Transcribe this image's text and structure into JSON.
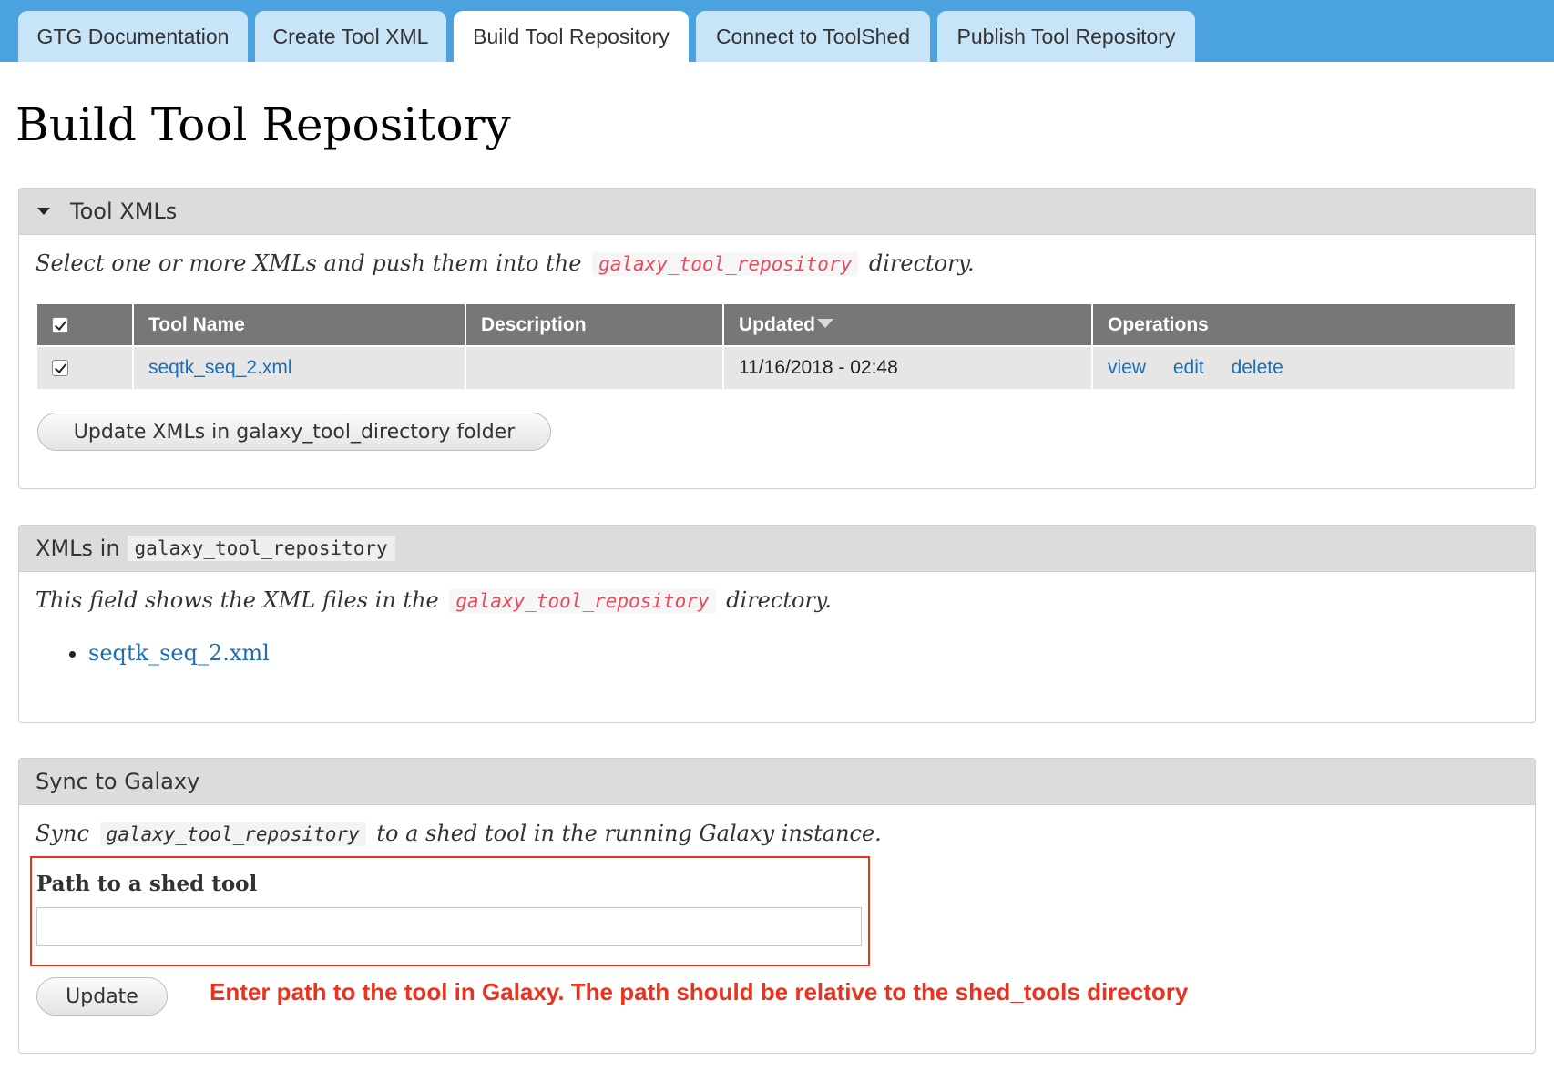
{
  "tabs": [
    {
      "label": "GTG Documentation",
      "active": false
    },
    {
      "label": "Create Tool XML",
      "active": false
    },
    {
      "label": "Build Tool Repository",
      "active": true
    },
    {
      "label": "Connect to ToolShed",
      "active": false
    },
    {
      "label": "Publish Tool Repository",
      "active": false
    }
  ],
  "page": {
    "title": "Build Tool Repository"
  },
  "tool_xmls": {
    "title": "Tool XMLs",
    "desc_before": "Select one or more XMLs and push them into the",
    "desc_code": "galaxy_tool_repository",
    "desc_after": "directory.",
    "table": {
      "headers": {
        "name": "Tool Name",
        "description": "Description",
        "updated": "Updated",
        "operations": "Operations"
      },
      "rows": [
        {
          "name": "seqtk_seq_2.xml",
          "description": "",
          "updated": "11/16/2018 - 02:48",
          "ops": [
            "view",
            "edit",
            "delete"
          ]
        }
      ]
    },
    "button": "Update XMLs in galaxy_tool_directory folder"
  },
  "xmls_in": {
    "title_prefix": "XMLs in",
    "title_code": "galaxy_tool_repository",
    "desc_before": "This field shows the XML files in the",
    "desc_code": "galaxy_tool_repository",
    "desc_after": "directory.",
    "files": [
      "seqtk_seq_2.xml"
    ]
  },
  "sync": {
    "title": "Sync to Galaxy",
    "desc_before": "Sync",
    "desc_code": "galaxy_tool_repository",
    "desc_after": "to a shed tool in the running Galaxy instance.",
    "field_label": "Path to a shed tool",
    "field_value": "",
    "button": "Update",
    "annotation": "Enter path to the tool in Galaxy. The path should be relative to the shed_tools directory"
  },
  "colors": {
    "tabbar": "#4aa3df",
    "tab": "#c8e4f8",
    "annotation": "#e8331f",
    "code": "#e74c5c",
    "link": "#1a6fb5"
  }
}
